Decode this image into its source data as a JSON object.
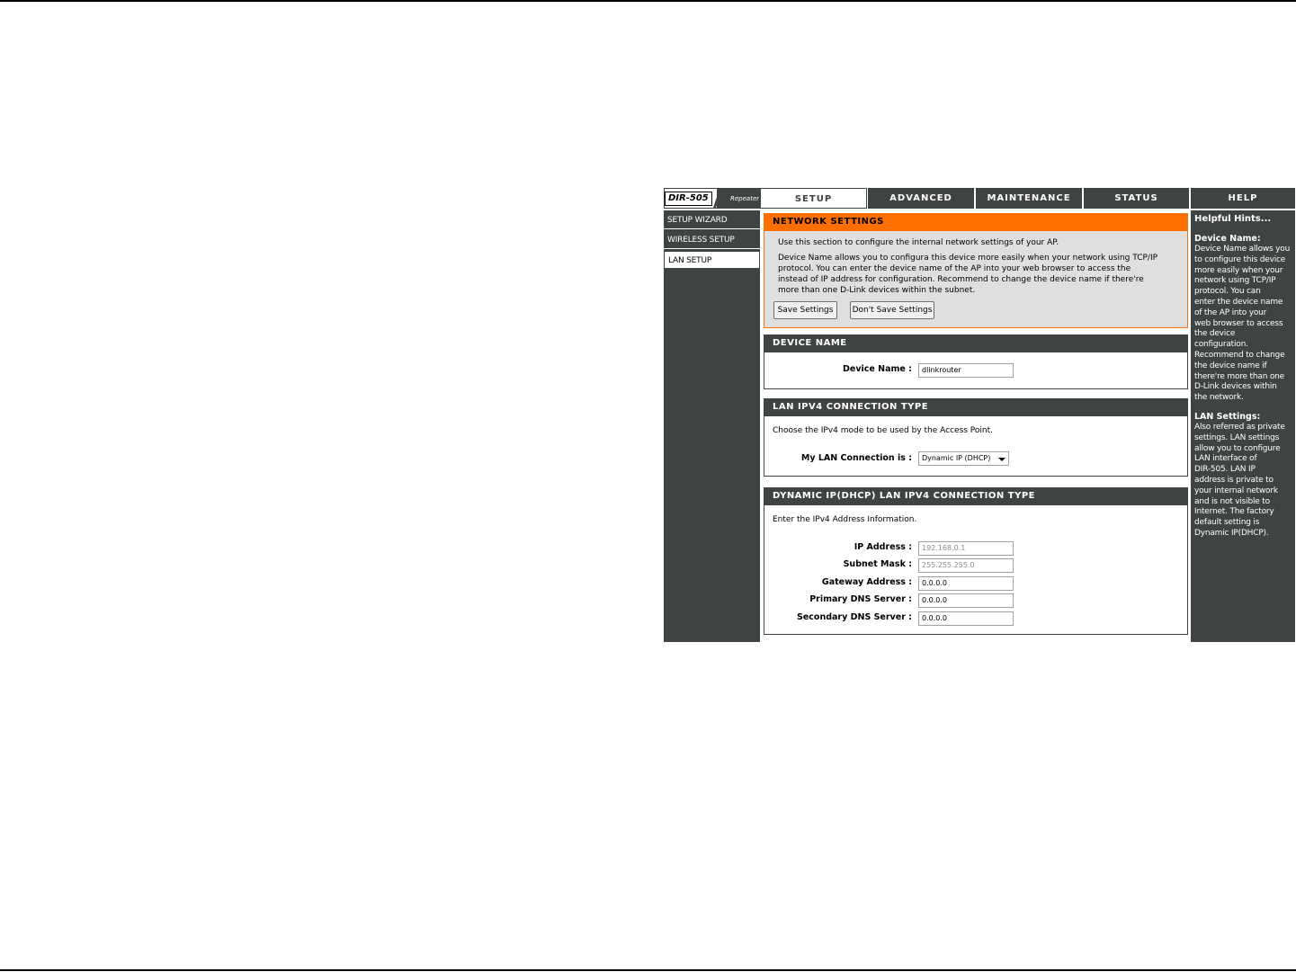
{
  "header": {
    "model": "DIR-505",
    "mode": "Repeater",
    "tabs": [
      "SETUP",
      "ADVANCED",
      "MAINTENANCE",
      "STATUS",
      "HELP"
    ]
  },
  "sidebar": {
    "items": [
      {
        "label": "SETUP WIZARD"
      },
      {
        "label": "WIRELESS SETUP"
      },
      {
        "label": "LAN SETUP"
      }
    ]
  },
  "network_settings": {
    "title": "NETWORK SETTINGS",
    "intro": "Use this section to configure the internal network settings of your AP.",
    "description_lines": [
      "Device Name allows you to configura this device more easily when your network using TCP/IP",
      "protocol. You can enter the device name of the AP into your web browser to access the",
      "instead of IP address for configuration. Recommend to change the device name if there're",
      "more than one D-Link devices within the subnet."
    ],
    "save_label": "Save Settings",
    "dont_save_label": "Don't Save Settings"
  },
  "device_name": {
    "title": "DEVICE NAME",
    "label": "Device Name :",
    "value": "dlinkrouter"
  },
  "lan_type": {
    "title": "LAN IPV4 CONNECTION TYPE",
    "intro": "Choose the IPv4 mode to be used by the Access Point.",
    "label": "My LAN Connection is :",
    "selected": "Dynamic IP (DHCP)"
  },
  "dhcp": {
    "title": "DYNAMIC IP(DHCP) LAN IPV4 CONNECTION TYPE",
    "intro": "Enter the IPv4 Address Information.",
    "fields": [
      {
        "label": "IP Address :",
        "value": "192.168.0.1"
      },
      {
        "label": "Subnet Mask :",
        "value": "255.255.255.0"
      },
      {
        "label": "Gateway Address :",
        "value": "0.0.0.0"
      },
      {
        "label": "Primary DNS Server :",
        "value": "0.0.0.0"
      },
      {
        "label": "Secondary DNS Server :",
        "value": "0.0.0.0"
      }
    ]
  },
  "hints": {
    "title": "Helpful Hints...",
    "device_name_title": "Device Name:",
    "device_name_lines": [
      "Device Name allows you",
      "to configure this device",
      "more easily when your",
      "network using TCP/IP",
      "protocol. You can",
      "enter the device name",
      "of the AP into your",
      "web browser to access",
      "the device",
      "configuration.",
      "Recommend to change",
      "the device name if",
      "there're more than one",
      "D-Link devices within",
      "the network."
    ],
    "lan_title": "LAN Settings:",
    "lan_lines": [
      "Also referred as private",
      "settings. LAN settings",
      "allow you to configure",
      "LAN interface of",
      "DIR-505. LAN IP",
      "address is private to",
      "your internal network",
      "and is not visible to",
      "Internet. The factory",
      "default setting is",
      "Dynamic IP(DHCP)."
    ]
  }
}
